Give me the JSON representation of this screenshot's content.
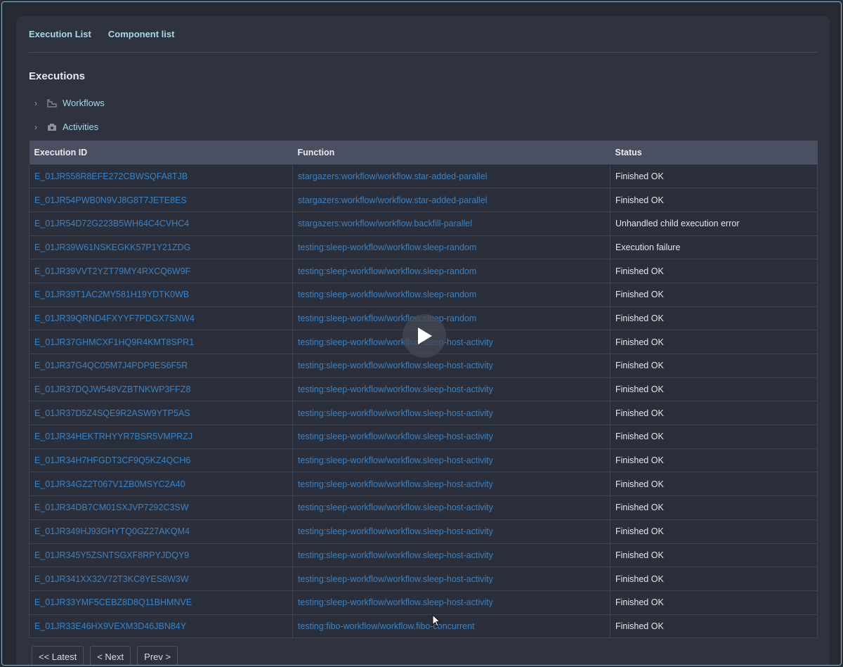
{
  "nav": {
    "items": [
      "Execution List",
      "Component list"
    ]
  },
  "page_title": "Executions",
  "tree": [
    {
      "label": "Workflows",
      "icon": "workflow-icon"
    },
    {
      "label": "Activities",
      "icon": "activity-icon"
    }
  ],
  "table": {
    "headers": [
      "Execution ID",
      "Function",
      "Status"
    ],
    "rows": [
      [
        "E_01JR558R8EFE272CBWSQFA8TJB",
        "stargazers:workflow/workflow.star-added-parallel",
        "Finished OK"
      ],
      [
        "E_01JR54PWB0N9VJ8G8T7JETE8ES",
        "stargazers:workflow/workflow.star-added-parallel",
        "Finished OK"
      ],
      [
        "E_01JR54D72G223B5WH64C4CVHC4",
        "stargazers:workflow/workflow.backfill-parallel",
        "Unhandled child execution error"
      ],
      [
        "E_01JR39W61NSKEGKK57P1Y21ZDG",
        "testing:sleep-workflow/workflow.sleep-random",
        "Execution failure"
      ],
      [
        "E_01JR39VVT2YZT79MY4RXCQ6W9F",
        "testing:sleep-workflow/workflow.sleep-random",
        "Finished OK"
      ],
      [
        "E_01JR39T1AC2MY581H19YDTK0WB",
        "testing:sleep-workflow/workflow.sleep-random",
        "Finished OK"
      ],
      [
        "E_01JR39QRND4FXYYF7PDGX7SNW4",
        "testing:sleep-workflow/workflow.sleep-random",
        "Finished OK"
      ],
      [
        "E_01JR37GHMCXF1HQ9R4KMT8SPR1",
        "testing:sleep-workflow/workflow.sleep-host-activity",
        "Finished OK"
      ],
      [
        "E_01JR37G4QC05M7J4PDP9ES6F5R",
        "testing:sleep-workflow/workflow.sleep-host-activity",
        "Finished OK"
      ],
      [
        "E_01JR37DQJW548VZBTNKWP3FFZ8",
        "testing:sleep-workflow/workflow.sleep-host-activity",
        "Finished OK"
      ],
      [
        "E_01JR37D5Z4SQE9R2ASW9YTP5AS",
        "testing:sleep-workflow/workflow.sleep-host-activity",
        "Finished OK"
      ],
      [
        "E_01JR34HEKTRHYYR7BSR5VMPRZJ",
        "testing:sleep-workflow/workflow.sleep-host-activity",
        "Finished OK"
      ],
      [
        "E_01JR34H7HFGDT3CF9Q5KZ4QCH6",
        "testing:sleep-workflow/workflow.sleep-host-activity",
        "Finished OK"
      ],
      [
        "E_01JR34GZ2T067V1ZB0MSYC2A40",
        "testing:sleep-workflow/workflow.sleep-host-activity",
        "Finished OK"
      ],
      [
        "E_01JR34DB7CM01SXJVP7292C3SW",
        "testing:sleep-workflow/workflow.sleep-host-activity",
        "Finished OK"
      ],
      [
        "E_01JR349HJ93GHYTQ0GZ27AKQM4",
        "testing:sleep-workflow/workflow.sleep-host-activity",
        "Finished OK"
      ],
      [
        "E_01JR345Y5ZSNTSGXF8RPYJDQY9",
        "testing:sleep-workflow/workflow.sleep-host-activity",
        "Finished OK"
      ],
      [
        "E_01JR341XX32V72T3KC8YES8W3W",
        "testing:sleep-workflow/workflow.sleep-host-activity",
        "Finished OK"
      ],
      [
        "E_01JR33YMF5CEBZ8D8Q11BHMNVE",
        "testing:sleep-workflow/workflow.sleep-host-activity",
        "Finished OK"
      ],
      [
        "E_01JR33E46HX9VEXM3D46JBN84Y",
        "testing:fibo-workflow/workflow.fibo-concurrent",
        "Finished OK"
      ]
    ]
  },
  "pager": {
    "latest": "<< Latest",
    "next": "< Next",
    "prev": "Prev >"
  },
  "colors": {
    "link": "#3b82c4",
    "nav": "#a9d8ea",
    "header_bg": "#4a5061"
  }
}
